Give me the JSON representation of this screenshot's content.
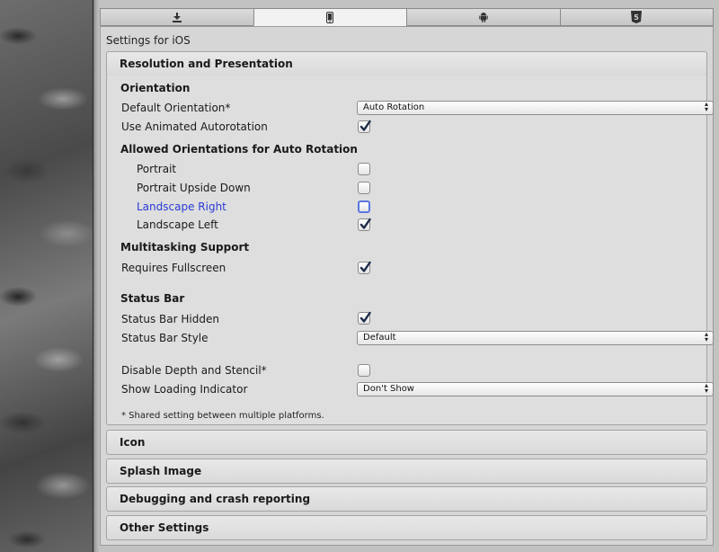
{
  "tabs": [
    {
      "icon": "download-icon",
      "active": false
    },
    {
      "icon": "iphone-icon",
      "active": true
    },
    {
      "icon": "android-icon",
      "active": false
    },
    {
      "icon": "html5-icon",
      "active": false
    }
  ],
  "settings_title": "Settings for iOS",
  "resolution": {
    "header": "Resolution and Presentation",
    "orientation_heading": "Orientation",
    "default_orientation_label": "Default Orientation*",
    "default_orientation_value": "Auto Rotation",
    "use_animated_autorotation_label": "Use Animated Autorotation",
    "use_animated_autorotation": true,
    "allowed_heading": "Allowed Orientations for Auto Rotation",
    "portrait_label": "Portrait",
    "portrait": false,
    "portrait_upside_down_label": "Portrait Upside Down",
    "portrait_upside_down": false,
    "landscape_right_label": "Landscape Right",
    "landscape_right": false,
    "landscape_left_label": "Landscape Left",
    "landscape_left": true,
    "multitasking_heading": "Multitasking Support",
    "requires_fullscreen_label": "Requires Fullscreen",
    "requires_fullscreen": true,
    "status_bar_heading": "Status Bar",
    "status_bar_hidden_label": "Status Bar Hidden",
    "status_bar_hidden": true,
    "status_bar_style_label": "Status Bar Style",
    "status_bar_style_value": "Default",
    "disable_depth_label": "Disable Depth and Stencil*",
    "disable_depth": false,
    "loading_indicator_label": "Show Loading Indicator",
    "loading_indicator_value": "Don't Show",
    "footnote": "* Shared setting between multiple platforms."
  },
  "sections": {
    "icon": "Icon",
    "splash": "Splash Image",
    "debugging": "Debugging and crash reporting",
    "other": "Other Settings"
  },
  "colors": {
    "focus_blue": "#2a3bd6",
    "panel_bg": "#dedede",
    "checkmark": "#1f2a4a"
  }
}
